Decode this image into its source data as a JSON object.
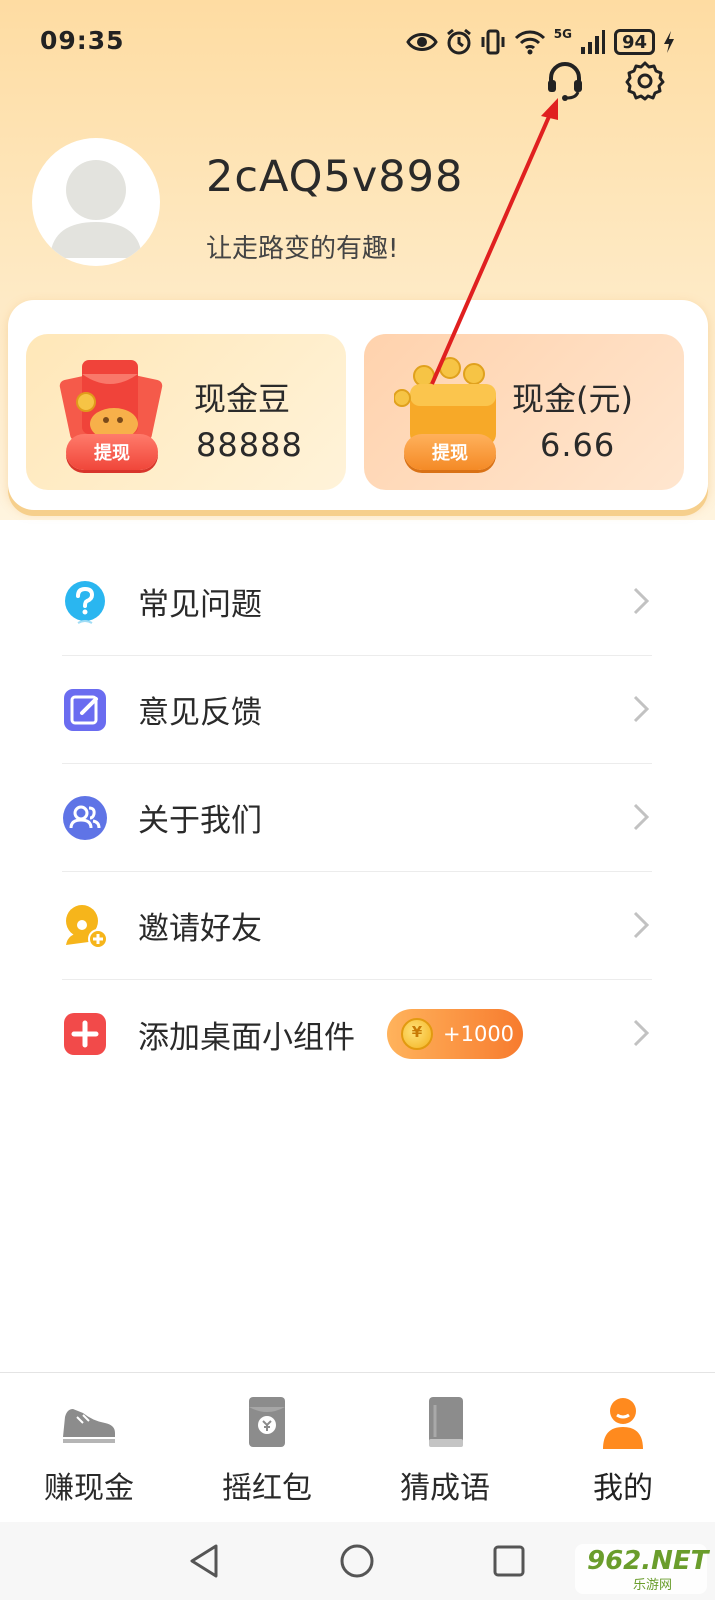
{
  "status_bar": {
    "time": "09:35",
    "network": "5G",
    "battery": "94",
    "icons": [
      "eye-icon",
      "alarm-icon",
      "vibrate-icon",
      "wifi-icon",
      "signal-icon",
      "charging-icon"
    ]
  },
  "header": {
    "support_icon": "headset-icon",
    "settings_icon": "gear-icon"
  },
  "profile": {
    "username": "2cAQ5v898",
    "slogan": "让走路变的有趣!"
  },
  "wallet": {
    "beans": {
      "title": "现金豆",
      "value": "88888",
      "action": "提现"
    },
    "cash": {
      "title": "现金(元)",
      "value": "6.66",
      "action": "提现"
    }
  },
  "menu": {
    "items": [
      {
        "label": "常见问题",
        "icon": "question-icon",
        "color": "#2ab6f0"
      },
      {
        "label": "意见反馈",
        "icon": "edit-icon",
        "color": "#6a6cf0"
      },
      {
        "label": "关于我们",
        "icon": "users-icon",
        "color": "#5f74e6"
      },
      {
        "label": "邀请好友",
        "icon": "invite-friend-icon",
        "color": "#f6b51b"
      },
      {
        "label": "添加桌面小组件",
        "icon": "plus-icon",
        "color": "#f24a4a",
        "badge": "+1000"
      }
    ]
  },
  "bottom_nav": {
    "active_color": "#ff8a1e",
    "items": [
      {
        "label": "赚现金",
        "icon": "shoe-icon"
      },
      {
        "label": "摇红包",
        "icon": "red-envelope-icon"
      },
      {
        "label": "猜成语",
        "icon": "book-icon"
      },
      {
        "label": "我的",
        "icon": "user-icon",
        "active": true
      }
    ]
  },
  "watermark": {
    "text": "962.NET",
    "sub": "乐游网"
  }
}
